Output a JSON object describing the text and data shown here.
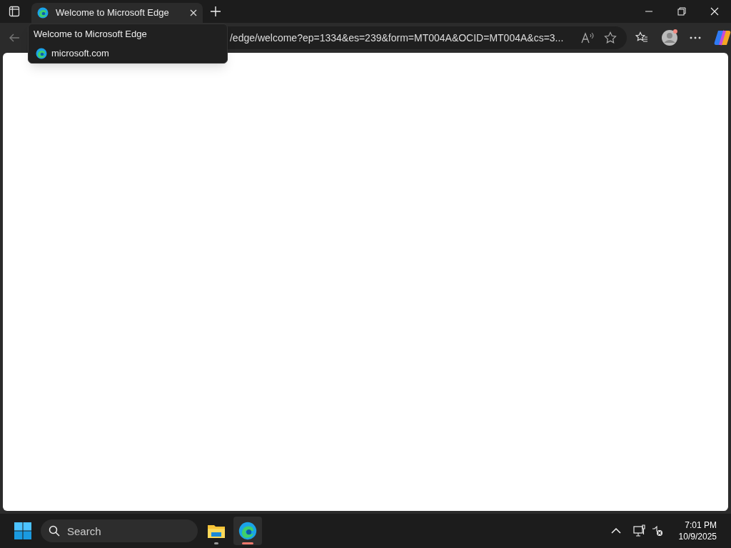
{
  "tabs": [
    {
      "title": "Welcome to Microsoft Edge",
      "selected": true
    }
  ],
  "tab_tooltip": {
    "title": "Welcome to Microsoft Edge",
    "site": "microsoft.com"
  },
  "address_bar": {
    "url": "/edge/welcome?ep=1334&es=239&form=MT004A&OCID=MT004A&cs=3..."
  },
  "taskbar": {
    "search": {
      "placeholder": "Search"
    },
    "apps": [
      {
        "kind": "files",
        "selected": false
      },
      {
        "kind": "edge",
        "selected": true
      }
    ],
    "time": "7:01 PM",
    "date": "10/9/2025"
  }
}
